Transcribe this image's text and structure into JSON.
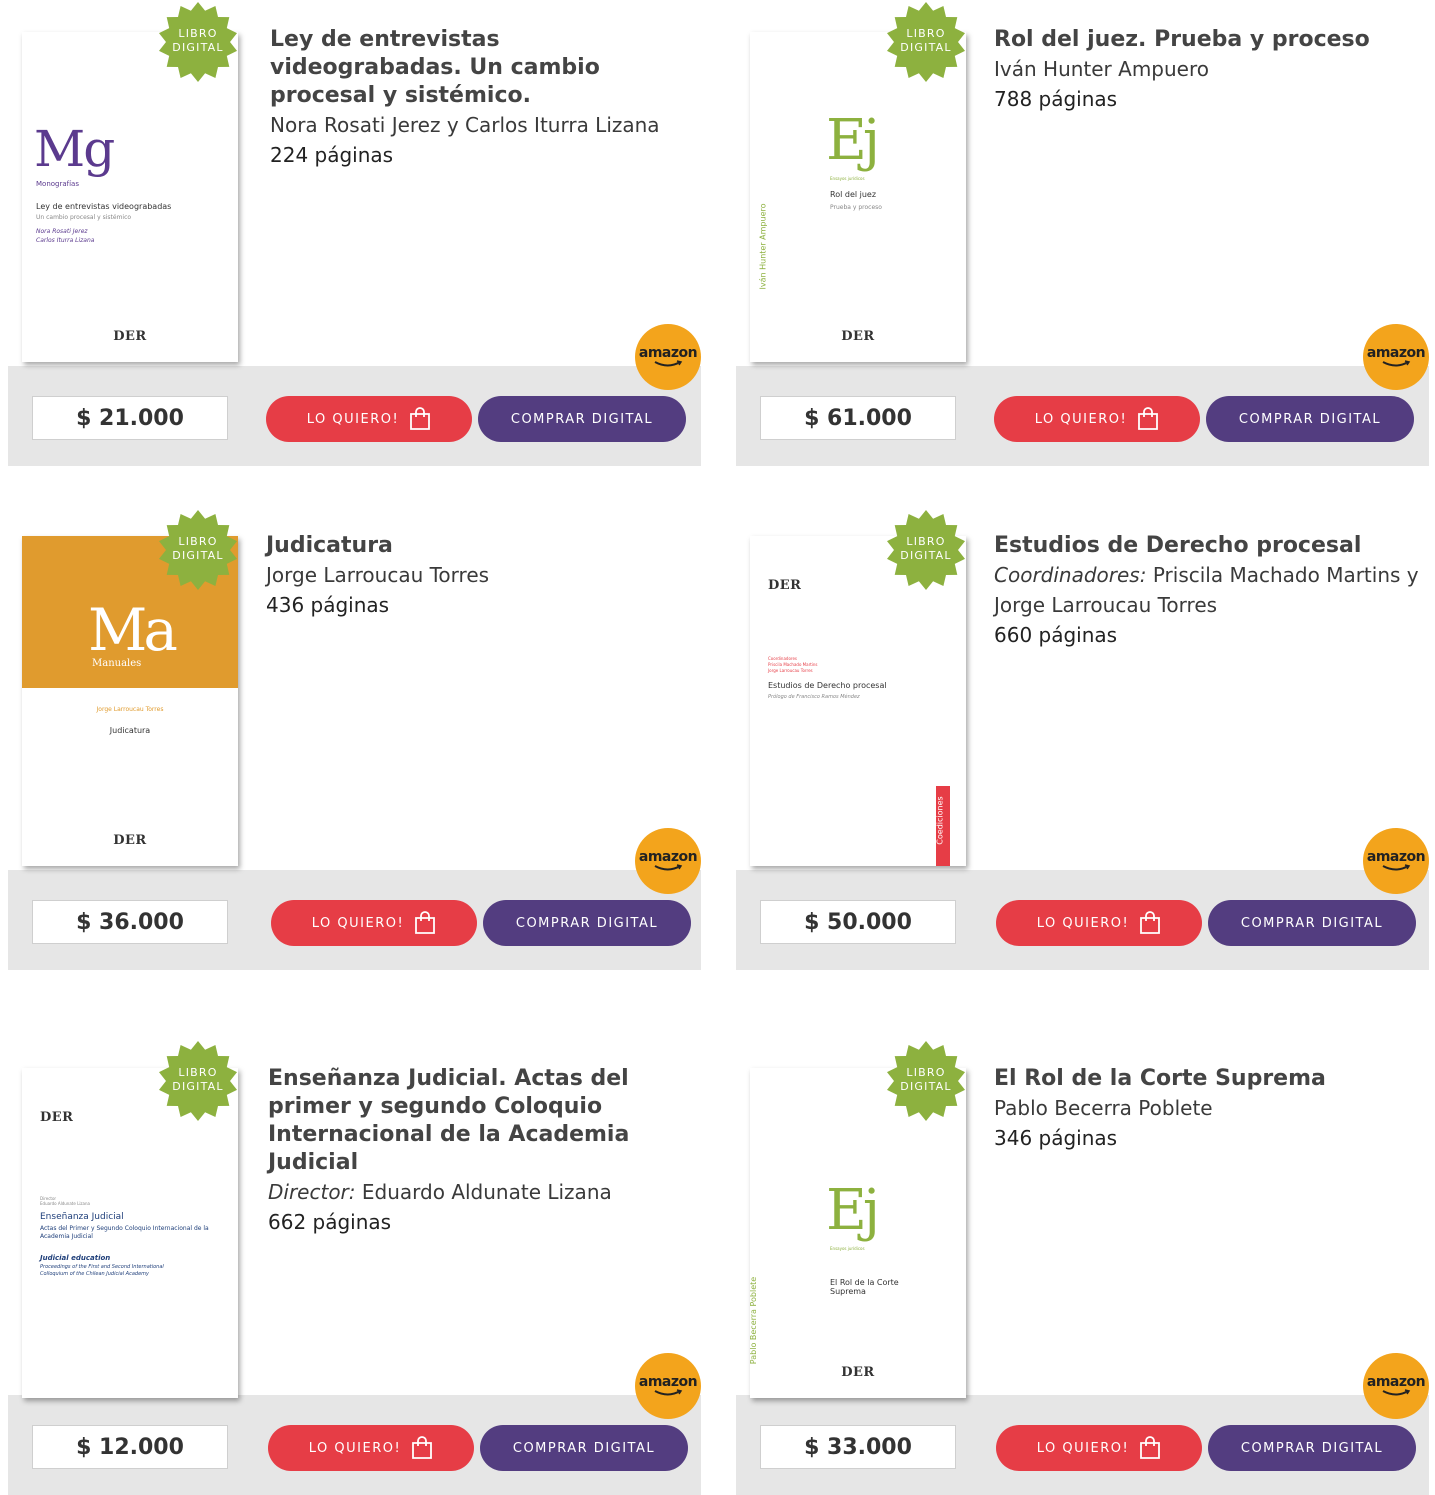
{
  "badge": [
    "LIBRO",
    "DIGITAL"
  ],
  "buttons": {
    "quiero": "LO QUIERO!",
    "comprar": "COMPRAR DIGITAL",
    "amazon": "amazon"
  },
  "colors": {
    "quiero": "#e63d46",
    "comprar": "#533d80",
    "amazon": "#f3a41c",
    "badge": "#8db13f",
    "band": "#e6e6e6"
  },
  "books": [
    {
      "title": "Ley de entrevistas videograbadas. Un cambio procesal y sistémico.",
      "author_prefix": "",
      "author": "Nora Rosati Jerez y Carlos Iturra Lizana",
      "pages": "224 páginas",
      "price": "$ 21.000",
      "cover": {
        "series_mark": "Mg",
        "series_name": "Monografías",
        "title": "Ley de entrevistas videograbadas",
        "subtitle": "Un cambio procesal y sistémico",
        "authors": [
          "Nora Rosati Jerez",
          "Carlos Iturra Lizana"
        ],
        "publisher": "DER"
      }
    },
    {
      "title": "Rol del juez. Prueba y proceso",
      "author_prefix": "",
      "author": "Iván Hunter Ampuero",
      "pages": "788 páginas",
      "price": "$ 61.000",
      "cover": {
        "series_mark": "Ej",
        "series_name": "Ensayos jurídicos",
        "title": "Rol del juez",
        "subtitle": "Prueba y proceso",
        "authors": [
          "Iván Hunter Ampuero"
        ],
        "publisher": "DER"
      }
    },
    {
      "title": "Judicatura",
      "author_prefix": "",
      "author": "Jorge Larroucau Torres",
      "pages": "436 páginas",
      "price": "$ 36.000",
      "cover": {
        "series_mark": "Ma",
        "series_name": "Manuales",
        "title": "Judicatura",
        "authors": [
          "Jorge Larroucau Torres"
        ],
        "publisher": "DER"
      }
    },
    {
      "title": "Estudios de Derecho procesal",
      "author_prefix": "Coordinadores:",
      "author": "Priscila Machado Martins y Jorge Larroucau Torres",
      "pages": "660 páginas",
      "price": "$ 50.000",
      "cover": {
        "label": "Coordinadores",
        "authors": [
          "Priscila Machado Martins",
          "Jorge Larroucau Torres"
        ],
        "title": "Estudios de Derecho procesal",
        "subtitle": "Prólogo de Francisco Ramos Méndez",
        "series_name": "Coediciones",
        "publisher": "DER"
      }
    },
    {
      "title": "Enseñanza Judicial. Actas del primer y segundo Coloquio Internacional de la Academia Judicial",
      "author_prefix": "Director:",
      "author": "Eduardo Aldunate Lizana",
      "pages": "662 páginas",
      "price": "$ 12.000",
      "cover": {
        "label": "Director",
        "authors": [
          "Eduardo Aldunate Lizana"
        ],
        "title": "Enseñanza Judicial",
        "subtitle": "Actas del Primer y Segundo Coloquio Internacional de la Academia Judicial",
        "title_en": "Judicial education",
        "subtitle_en": "Proceedings of the First and Second International Colloquium of the Chilean Judicial Academy",
        "publisher": "DER"
      }
    },
    {
      "title": "El Rol de la Corte Suprema",
      "author_prefix": "",
      "author": "Pablo Becerra Poblete",
      "pages": "346 páginas",
      "price": "$ 33.000",
      "cover": {
        "series_mark": "Ej",
        "series_name": "Ensayos jurídicos",
        "title": "El Rol de la Corte Suprema",
        "authors": [
          "Pablo Becerra Poblete"
        ],
        "publisher": "DER"
      }
    }
  ]
}
